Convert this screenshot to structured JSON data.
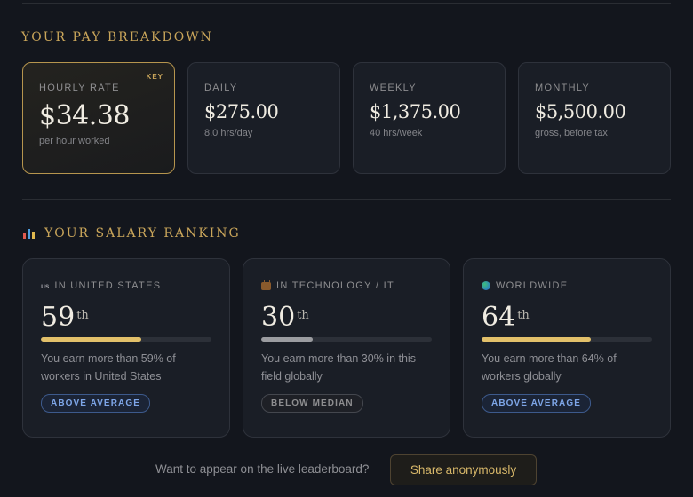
{
  "pay_breakdown": {
    "title": "YOUR PAY BREAKDOWN",
    "key_badge": "KEY",
    "cards": [
      {
        "label": "HOURLY RATE",
        "value": "$34.38",
        "sub": "per hour worked"
      },
      {
        "label": "DAILY",
        "value": "$275.00",
        "sub": "8.0 hrs/day"
      },
      {
        "label": "WEEKLY",
        "value": "$1,375.00",
        "sub": "40 hrs/week"
      },
      {
        "label": "MONTHLY",
        "value": "$5,500.00",
        "sub": "gross, before tax"
      }
    ]
  },
  "salary_ranking": {
    "title": "YOUR SALARY RANKING",
    "title_icon": "bar-chart-icon",
    "cards": [
      {
        "icon": "us-flag-icon",
        "icon_text": "us",
        "label": "IN UNITED STATES",
        "rank": "59",
        "suffix": "th",
        "percentile": 59,
        "bar_color": "#e2c06a",
        "desc": "You earn more than 59% of workers in United States",
        "badge": "ABOVE AVERAGE"
      },
      {
        "icon": "briefcase-icon",
        "label": "IN TECHNOLOGY / IT",
        "rank": "30",
        "suffix": "th",
        "percentile": 30,
        "bar_color": "#9b9ca0",
        "desc": "You earn more than 30% in this field globally",
        "badge": "BELOW MEDIAN"
      },
      {
        "icon": "globe-icon",
        "label": "WORLDWIDE",
        "rank": "64",
        "suffix": "th",
        "percentile": 64,
        "bar_color": "#e2c06a",
        "desc": "You earn more than 64% of workers globally",
        "badge": "ABOVE AVERAGE"
      }
    ]
  },
  "cta": {
    "text": "Want to appear on the live leaderboard?",
    "button_label": "Share anonymously"
  },
  "colors": {
    "accent_gold": "#c9a55a",
    "above_badge": "#7ea6e8",
    "background": "#13161d"
  }
}
